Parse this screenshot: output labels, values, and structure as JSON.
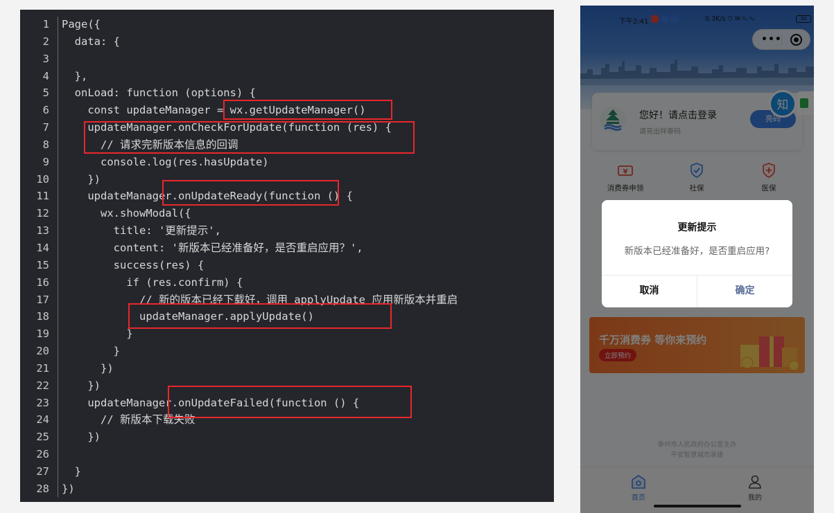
{
  "code_editor": {
    "line_numbers": [
      "1",
      "2",
      "3",
      "4",
      "5",
      "6",
      "7",
      "8",
      "9",
      "10",
      "11",
      "12",
      "13",
      "14",
      "15",
      "16",
      "17",
      "18",
      "19",
      "20",
      "21",
      "22",
      "23",
      "24",
      "25",
      "26",
      "27",
      "28"
    ],
    "lines": [
      "Page({",
      "  data: {",
      "",
      "  },",
      "  onLoad: function (options) {",
      "    const updateManager = wx.getUpdateManager()",
      "    updateManager.onCheckForUpdate(function (res) {",
      "      // 请求完新版本信息的回调",
      "      console.log(res.hasUpdate)",
      "    })",
      "    updateManager.onUpdateReady(function () {",
      "      wx.showModal({",
      "        title: '更新提示',",
      "        content: '新版本已经准备好，是否重启应用？',",
      "        success(res) {",
      "          if (res.confirm) {",
      "            // 新的版本已经下载好，调用 applyUpdate 应用新版本并重启",
      "            updateManager.applyUpdate()",
      "          }",
      "        }",
      "      })",
      "    })",
      "    updateManager.onUpdateFailed(function () {",
      "      // 新版本下载失败",
      "    })",
      "",
      "  }",
      "})"
    ],
    "highlight_color": "#e8272b"
  },
  "phone": {
    "status_bar": {
      "time": "下午2:41",
      "network": "0.3K/s ⏱ ✉ ᵍᵢₗ ᵍᵢₗ",
      "battery": "34"
    },
    "capsule": {
      "more": "•••"
    },
    "login_card": {
      "title": "您好！请点击登录",
      "subtitle": "请亮出祥泰码",
      "button": "亮码"
    },
    "floating": {
      "zhi": "知"
    },
    "services": [
      {
        "label": "消费券申领",
        "icon": "voucher-icon"
      },
      {
        "label": "社保",
        "icon": "shield-check-icon"
      },
      {
        "label": "医保",
        "icon": "medical-shield-icon"
      }
    ],
    "promo": {
      "title": "千万消费券 等你来预约",
      "button": "立即预约"
    },
    "footer": {
      "line1": "泰州市人民政府办公室主办",
      "line2": "平安智慧城市承建"
    },
    "tabbar": [
      {
        "label": "首页",
        "icon": "home-icon",
        "active": true
      },
      {
        "label": "我的",
        "icon": "user-icon",
        "active": false
      }
    ],
    "modal": {
      "title": "更新提示",
      "content": "新版本已经准备好，是否重启应用?",
      "cancel": "取消",
      "confirm": "确定"
    },
    "colors": {
      "primary_blue": "#3a7de0",
      "confirm_text": "#576b95",
      "tab_active": "#3a7de0",
      "promo_orange": "#f8722f"
    }
  }
}
